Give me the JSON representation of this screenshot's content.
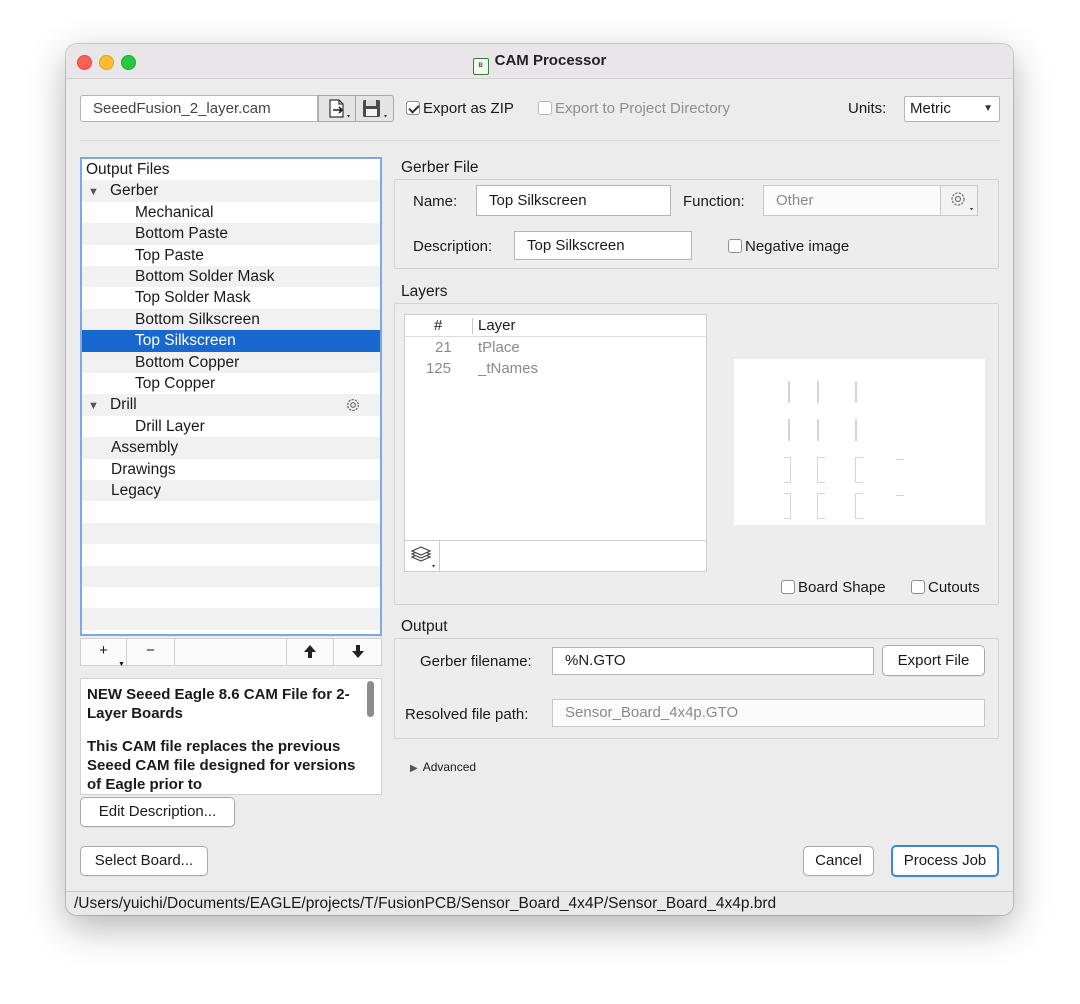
{
  "window": {
    "title": "CAM Processor"
  },
  "toolbar": {
    "cam_file": "SeeedFusion_2_layer.cam",
    "export_zip_label": "Export as ZIP",
    "export_zip_checked": true,
    "export_project_dir_label": "Export to Project Directory",
    "export_project_dir_checked": false,
    "units_label": "Units:",
    "units_value": "Metric"
  },
  "tree": {
    "header": "Output Files",
    "rows": [
      {
        "label": "Gerber",
        "level": 1,
        "expanded": true
      },
      {
        "label": "Mechanical",
        "level": 2
      },
      {
        "label": "Bottom Paste",
        "level": 2
      },
      {
        "label": "Top Paste",
        "level": 2
      },
      {
        "label": "Bottom Solder Mask",
        "level": 2
      },
      {
        "label": "Top Solder Mask",
        "level": 2
      },
      {
        "label": "Bottom Silkscreen",
        "level": 2
      },
      {
        "label": "Top Silkscreen",
        "level": 2,
        "selected": true
      },
      {
        "label": "Bottom Copper",
        "level": 2
      },
      {
        "label": "Top Copper",
        "level": 2
      },
      {
        "label": "Drill",
        "level": 1,
        "expanded": true,
        "gear": true
      },
      {
        "label": "Drill Layer",
        "level": 2
      },
      {
        "label": "Assembly",
        "level": 1
      },
      {
        "label": "Drawings",
        "level": 1
      },
      {
        "label": "Legacy",
        "level": 1
      }
    ]
  },
  "tree_toolbar": {
    "add": "+",
    "remove": "−",
    "up": "🡅",
    "down": "🡇"
  },
  "description": {
    "title": "NEW Seeed Eagle 8.6 CAM File for 2-Layer Boards",
    "body": "This CAM file replaces the previous Seeed CAM file designed for versions of Eagle prior to",
    "edit_button": "Edit Description..."
  },
  "gerber_file": {
    "section_title": "Gerber File",
    "name_label": "Name:",
    "name_value": "Top Silkscreen",
    "function_label": "Function:",
    "function_value": "Other",
    "description_label": "Description:",
    "description_value": "Top Silkscreen",
    "negative_image_label": "Negative image",
    "negative_image_checked": false
  },
  "layers": {
    "section_title": "Layers",
    "col_num": "#",
    "col_layer": "Layer",
    "rows": [
      {
        "num": "21",
        "name": "tPlace"
      },
      {
        "num": "125",
        "name": "_tNames"
      }
    ],
    "board_shape_label": "Board Shape",
    "cutouts_label": "Cutouts"
  },
  "output": {
    "section_title": "Output",
    "filename_label": "Gerber filename:",
    "filename_value": "%N.GTO",
    "export_file_button": "Export File",
    "resolved_label": "Resolved file path:",
    "resolved_value": "Sensor_Board_4x4p.GTO"
  },
  "advanced_label": "Advanced",
  "buttons": {
    "select_board": "Select Board...",
    "cancel": "Cancel",
    "process_job": "Process Job"
  },
  "status": {
    "path": "/Users/yuichi/Documents/EAGLE/projects/T/FusionPCB/Sensor_Board_4x4P/Sensor_Board_4x4p.brd"
  },
  "colors": {
    "accent": "#1868d0",
    "focus": "#3b87d4"
  }
}
